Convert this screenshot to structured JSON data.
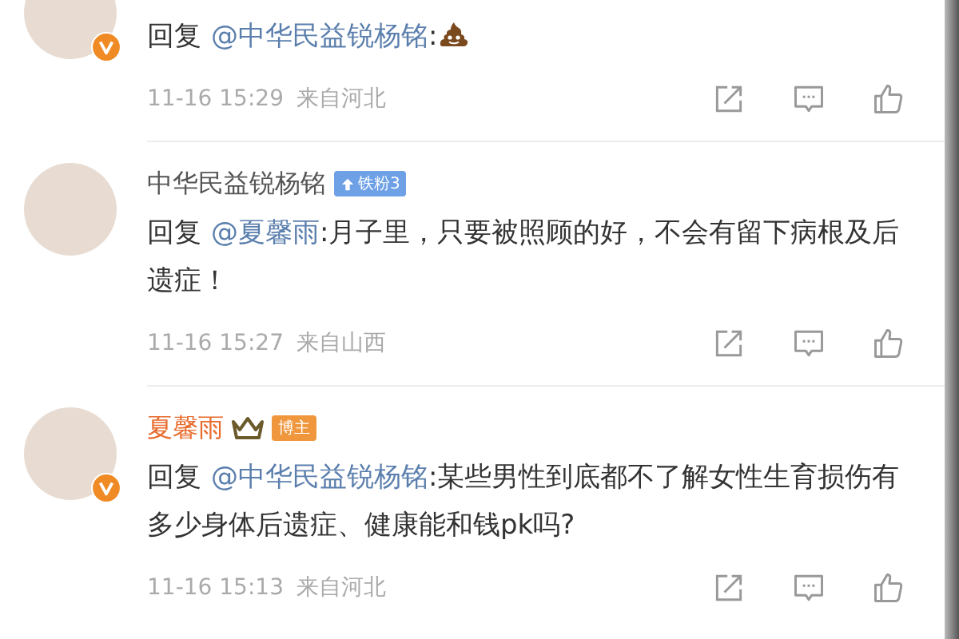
{
  "comments": [
    {
      "verified": true,
      "prefix": "回复",
      "mention": "@中华民益锐杨铭",
      "text": ":",
      "emoji": {
        "kind": "poop"
      },
      "time": "11-16 15:29",
      "location": "来自河北"
    },
    {
      "name": "中华民益锐杨铭",
      "member": false,
      "crown": false,
      "badge": {
        "kind": "fan",
        "label": "铁粉3"
      },
      "verified": false,
      "prefix": "回复",
      "mention": "@夏馨雨",
      "text": ":月子里，只要被照顾的好，不会有留下病根及后遗症！",
      "time": "11-16 15:27",
      "location": "来自山西"
    },
    {
      "name": "夏馨雨",
      "member": true,
      "crown": true,
      "badge": {
        "kind": "blogger",
        "label": "博主"
      },
      "verified": true,
      "prefix": "回复",
      "mention": "@中华民益锐杨铭",
      "text": ":某些男性到底都不了解女性生育损伤有多少身体后遗症、健康能和钱pk吗?",
      "time": "11-16 15:13",
      "location": "来自河北"
    }
  ]
}
